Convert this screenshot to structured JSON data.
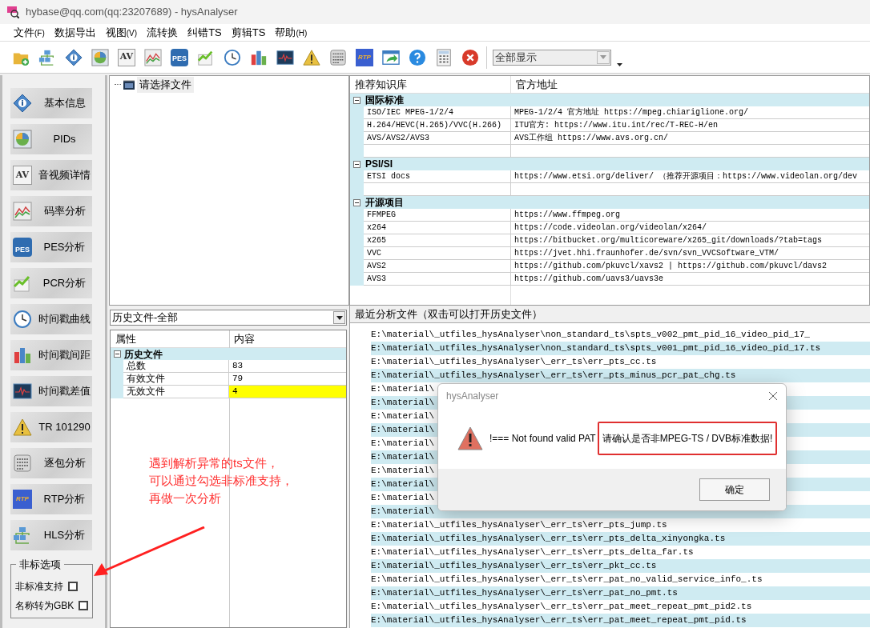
{
  "window": {
    "title": "hybase@qq.com(qq:23207689) - hysAnalyser"
  },
  "menu": [
    {
      "label": "文件",
      "accel": "(F)"
    },
    {
      "label": "数据导出"
    },
    {
      "label": "视图",
      "accel": "(V)"
    },
    {
      "label": "流转换"
    },
    {
      "label": "纠错TS"
    },
    {
      "label": "剪辑TS"
    },
    {
      "label": "帮助",
      "accel": "(H)"
    }
  ],
  "toolbar": {
    "icons": [
      {
        "kind": "folder"
      },
      {
        "kind": "network"
      },
      {
        "kind": "info"
      },
      {
        "kind": "pie"
      },
      {
        "kind": "text",
        "text": "AV"
      },
      {
        "kind": "chart"
      },
      {
        "kind": "pes",
        "text": "PES"
      },
      {
        "kind": "trend"
      },
      {
        "kind": "clock"
      },
      {
        "kind": "bars"
      },
      {
        "kind": "monitor"
      },
      {
        "kind": "warning"
      },
      {
        "kind": "binary"
      },
      {
        "kind": "rtp",
        "text": "RTP"
      },
      {
        "kind": "export"
      },
      {
        "kind": "help"
      },
      {
        "kind": "calc"
      },
      {
        "kind": "close"
      }
    ],
    "view_select": "全部显示"
  },
  "sidebar": {
    "buttons": [
      {
        "label": "基本信息",
        "kind": "info"
      },
      {
        "label": "PIDs",
        "kind": "pie"
      },
      {
        "label": "音视频详情",
        "kind": "text",
        "icon_text": "AV"
      },
      {
        "label": "码率分析",
        "kind": "chart"
      },
      {
        "label": "PES分析",
        "kind": "pes",
        "icon_text": "PES"
      },
      {
        "label": "PCR分析",
        "kind": "trend"
      },
      {
        "label": "时间戳曲线",
        "kind": "clock"
      },
      {
        "label": "时间戳间距",
        "kind": "bars"
      },
      {
        "label": "时间戳差值",
        "kind": "monitor"
      },
      {
        "label": "TR 101290",
        "kind": "warning"
      },
      {
        "label": "逐包分析",
        "kind": "binary"
      },
      {
        "label": "RTP分析",
        "kind": "rtp",
        "icon_text": "RTP"
      },
      {
        "label": "HLS分析",
        "kind": "network"
      }
    ],
    "options": {
      "title": "非标选项",
      "items": [
        {
          "label": "非标准支持",
          "checked": false
        },
        {
          "label": "名称转为GBK",
          "checked": false
        }
      ]
    }
  },
  "file_tree": {
    "items": [
      "请选择文件"
    ]
  },
  "knowledge_table": {
    "columns": [
      "推荐知识库",
      "官方地址"
    ],
    "groups": [
      {
        "title": "国际标准",
        "expanded": true,
        "rows": [
          {
            "name": "ISO/IEC MPEG-1/2/4",
            "url": "MPEG-1/2/4 官方地址 https://mpeg.chiariglione.org/"
          },
          {
            "name": "H.264/HEVC(H.265)/VVC(H.266)",
            "url": "ITU官方: https://www.itu.int/rec/T-REC-H/en"
          },
          {
            "name": "AVS/AVS2/AVS3",
            "url": "AVS工作组  https://www.avs.org.cn/"
          }
        ]
      },
      {
        "title": "PSI/SI",
        "expanded": true,
        "rows": [
          {
            "name": "ETSI docs",
            "url": "https://www.etsi.org/deliver/ （推荐开源项目：https://www.videolan.org/dev"
          }
        ]
      },
      {
        "title": "开源项目",
        "expanded": true,
        "rows": [
          {
            "name": "FFMPEG",
            "url": "https://www.ffmpeg.org"
          },
          {
            "name": "x264",
            "url": "https://code.videolan.org/videolan/x264/"
          },
          {
            "name": "x265",
            "url": "https://bitbucket.org/multicoreware/x265_git/downloads/?tab=tags"
          },
          {
            "name": "VVC",
            "url": "https://jvet.hhi.fraunhofer.de/svn/svn_VVCSoftware_VTM/"
          },
          {
            "name": "AVS2",
            "url": "https://github.com/pkuvcl/xavs2  |  https://github.com/pkuvcl/davs2"
          },
          {
            "name": "AVS3",
            "url": "https://github.com/uavs3/uavs3e"
          }
        ]
      }
    ]
  },
  "history_select": "历史文件-全部",
  "property_table": {
    "columns": [
      "属性",
      "内容"
    ],
    "groups": [
      {
        "title": "历史文件",
        "expanded": true,
        "rows": [
          {
            "name": "总数",
            "value": "83",
            "highlighted": false
          },
          {
            "name": "有效文件",
            "value": "79",
            "highlighted": false
          },
          {
            "name": "无效文件",
            "value": "4",
            "highlighted": true
          }
        ]
      }
    ]
  },
  "recent_files": {
    "title": "最近分析文件（双击可以打开历史文件）",
    "rows": [
      "E:\\material\\_utfiles_hysAnalyser\\non_standard_ts\\spts_v002_pmt_pid_16_video_pid_17_",
      "E:\\material\\_utfiles_hysAnalyser\\non_standard_ts\\spts_v001_pmt_pid_16_video_pid_17.ts",
      "E:\\material\\_utfiles_hysAnalyser\\_err_ts\\err_pts_cc.ts",
      "E:\\material\\_utfiles_hysAnalyser\\_err_ts\\err_pts_minus_pcr_pat_chg.ts",
      "E:\\material\\",
      "E:\\material\\",
      "E:\\material\\",
      "E:\\material\\",
      "E:\\material\\",
      "E:\\material\\",
      "E:\\material\\",
      "E:\\material\\",
      "E:\\material\\",
      "E:\\material\\",
      "E:\\material\\_utfiles_hysAnalyser\\_err_ts\\err_pts_jump.ts",
      "E:\\material\\_utfiles_hysAnalyser\\_err_ts\\err_pts_delta_xinyongka.ts",
      "E:\\material\\_utfiles_hysAnalyser\\_err_ts\\err_pts_delta_far.ts",
      "E:\\material\\_utfiles_hysAnalyser\\_err_ts\\err_pkt_cc.ts",
      "E:\\material\\_utfiles_hysAnalyser\\_err_ts\\err_pat_no_valid_service_info_.ts",
      "E:\\material\\_utfiles_hysAnalyser\\_err_ts\\err_pat_no_pmt.ts",
      "E:\\material\\_utfiles_hysAnalyser\\_err_ts\\err_pat_meet_repeat_pmt_pid2.ts",
      "E:\\material\\_utfiles_hysAnalyser\\_err_ts\\err_pat_meet_repeat_pmt_pid.ts"
    ]
  },
  "dialog": {
    "title": "hysAnalyser",
    "message": "!=== Not found valid PAT",
    "highlighted_message": "请确认是否非MPEG-TS / DVB标准数据!",
    "ok": "确定"
  },
  "annotation": {
    "lines": [
      "遇到解析异常的ts文件，",
      "可以通过勾选非标准支持，",
      "再做一次分析"
    ]
  }
}
